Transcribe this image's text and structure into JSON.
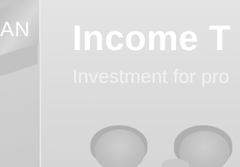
{
  "side_text": "AN",
  "headline": "Income T",
  "tagline": "Investment for pro",
  "colors": {
    "background": "#dcdcdc",
    "text": "#ffffff"
  }
}
